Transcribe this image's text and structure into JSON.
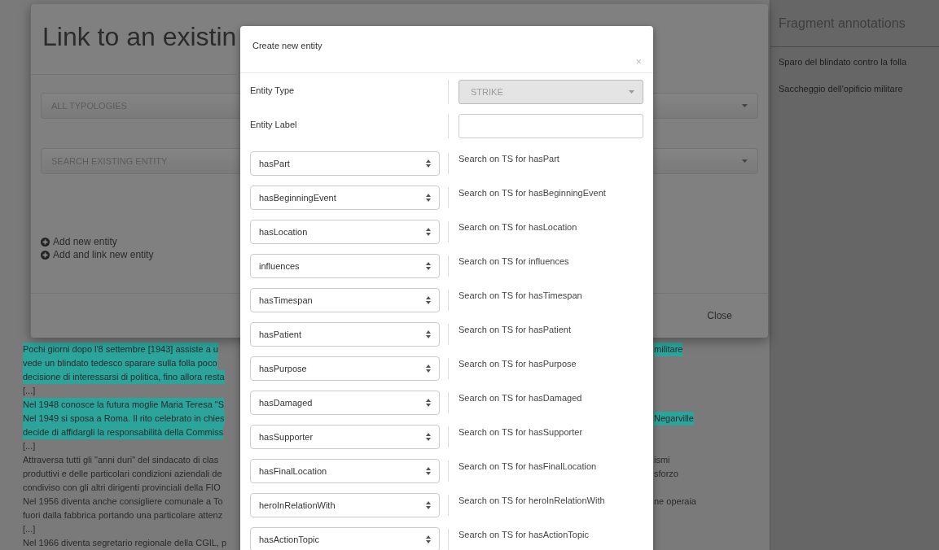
{
  "document_text": {
    "lines": [
      {
        "left": "Pochi giorni dopo l'8 settembre [1943] assiste a u",
        "right": "militare",
        "highlighted": true
      },
      {
        "left": "vede un blindato tedesco sparare sulla folla poco",
        "highlighted": true
      },
      {
        "left": "decisione di interessarsi di politica, fino allora resta",
        "highlighted": true
      },
      {
        "left": "[...]",
        "highlighted": false
      },
      {
        "left": "Nel 1948 conosce la futura moglie Maria Teresa \"S",
        "highlighted": true
      },
      {
        "left": "Nel 1949 si sposa a Roma. Il rito celebrato in chies",
        "right": "Negarville",
        "highlighted": true
      },
      {
        "left": "decide di affidargli la responsabilità della Commiss",
        "highlighted": true
      },
      {
        "left": "[...]",
        "highlighted": false
      },
      {
        "left": "Attraversa tutti gli \"anni duri\" del sindacato di clas",
        "right": "ismi",
        "highlighted": false
      },
      {
        "left": "produttivi e delle particolari condizioni aziendali de",
        "right": "sforzo",
        "highlighted": false
      },
      {
        "left": "condiviso con gli altri dirigenti provinciali della FIO",
        "highlighted": false
      },
      {
        "left": "Nel 1956 diventa anche consigliere comunale a To",
        "right": "ne operaia",
        "highlighted": false
      },
      {
        "left": "fuori dalla fabbrica portando una particolare attenz",
        "highlighted": false
      },
      {
        "left": "[...]",
        "highlighted": false
      },
      {
        "left": "Nel 1966 diventa segretario regionale della CGIL, p",
        "highlighted": false
      }
    ]
  },
  "annotations_panel": {
    "title": "Fragment annotations",
    "items": [
      "Sparo del blindato contro la folla",
      "Saccheggio dell'opificio militare"
    ]
  },
  "background_modal": {
    "title": "Link to an existin",
    "typology_select": "ALL TYPOLOGIES",
    "entity_search": "SEARCH EXISTING ENTITY",
    "actions": [
      "Add new entity",
      "Add and link new entity"
    ],
    "close": "Close"
  },
  "create_entity": {
    "title": "Create new entity",
    "close": "×",
    "entity_type": {
      "label": "Entity Type",
      "value": "STRIKE",
      "disabled": true
    },
    "entity_label": {
      "label": "Entity Label"
    },
    "relations": [
      {
        "property": "hasPart",
        "search": "Search on TS for hasPart"
      },
      {
        "property": "hasBeginningEvent",
        "search": "Search on TS for hasBeginningEvent"
      },
      {
        "property": "hasLocation",
        "search": "Search on TS for hasLocation"
      },
      {
        "property": "influences",
        "search": "Search on TS for influences"
      },
      {
        "property": "hasTimespan",
        "search": "Search on TS for hasTimespan"
      },
      {
        "property": "hasPatient",
        "search": "Search on TS for hasPatient"
      },
      {
        "property": "hasPurpose",
        "search": "Search on TS for hasPurpose"
      },
      {
        "property": "hasDamaged",
        "search": "Search on TS for hasDamaged"
      },
      {
        "property": "hasSupporter",
        "search": "Search on TS for hasSupporter"
      },
      {
        "property": "hasFinalLocation",
        "search": "Search on TS for hasFinalLocation"
      },
      {
        "property": "heroInRelationWith",
        "search": "Search on TS for heroInRelationWith"
      },
      {
        "property": "hasActionTopic",
        "search": "Search on TS for hasActionTopic"
      }
    ]
  }
}
